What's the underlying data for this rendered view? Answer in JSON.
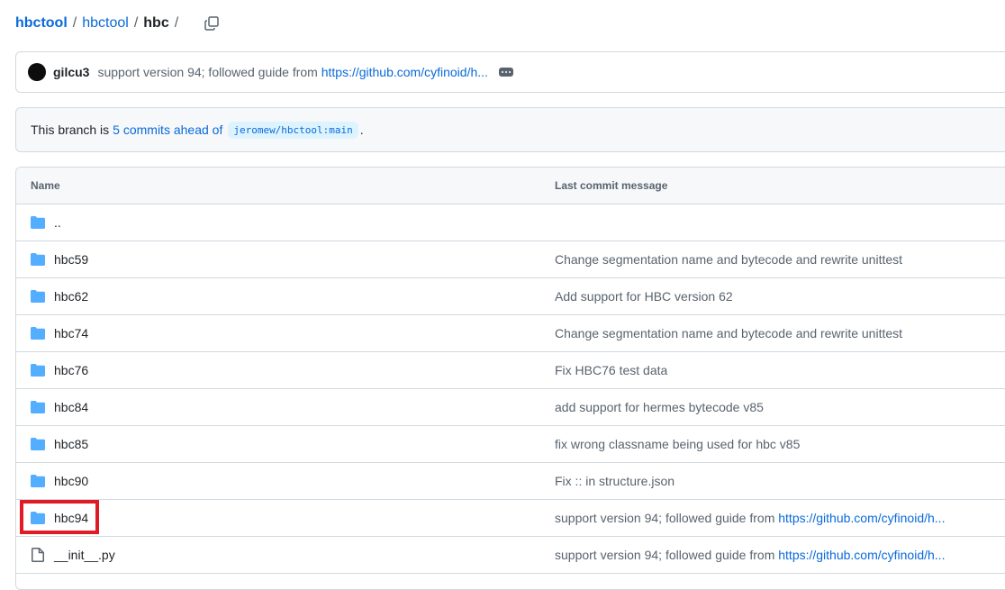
{
  "breadcrumb": {
    "items": [
      "hbctool",
      "hbctool",
      "hbc"
    ],
    "separator": "/"
  },
  "commit": {
    "author": "gilcu3",
    "message": "support version 94; followed guide from",
    "link": "https://github.com/cyfinoid/h..."
  },
  "branch": {
    "prefix": "This branch is",
    "link": "5 commits ahead of",
    "ref": "jeromew/hbctool:main",
    "suffix": "."
  },
  "table": {
    "headers": {
      "name": "Name",
      "message": "Last commit message"
    },
    "rows": [
      {
        "name": "..",
        "type": "folder",
        "message": "",
        "link": ""
      },
      {
        "name": "hbc59",
        "type": "folder",
        "message": "Change segmentation name and bytecode and rewrite unittest",
        "link": ""
      },
      {
        "name": "hbc62",
        "type": "folder",
        "message": "Add support for HBC version 62",
        "link": ""
      },
      {
        "name": "hbc74",
        "type": "folder",
        "message": "Change segmentation name and bytecode and rewrite unittest",
        "link": ""
      },
      {
        "name": "hbc76",
        "type": "folder",
        "message": "Fix HBC76 test data",
        "link": ""
      },
      {
        "name": "hbc84",
        "type": "folder",
        "message": "add support for hermes bytecode v85",
        "link": ""
      },
      {
        "name": "hbc85",
        "type": "folder",
        "message": "fix wrong classname being used for hbc v85",
        "link": ""
      },
      {
        "name": "hbc90",
        "type": "folder",
        "message": "Fix :: in structure.json",
        "link": ""
      },
      {
        "name": "hbc94",
        "type": "folder",
        "message": "support version 94; followed guide from ",
        "link": "https://github.com/cyfinoid/h..."
      },
      {
        "name": "__init__.py",
        "type": "file",
        "message": "support version 94; followed guide from ",
        "link": "https://github.com/cyfinoid/h..."
      }
    ]
  },
  "colors": {
    "link": "#0969da",
    "muted": "#59636e",
    "folder": "#54aeff",
    "highlight": "#e01b24"
  },
  "icons": {
    "copy": "copy-icon",
    "folder": "folder-icon",
    "file": "file-icon",
    "ellipsis": "ellipsis-icon"
  }
}
